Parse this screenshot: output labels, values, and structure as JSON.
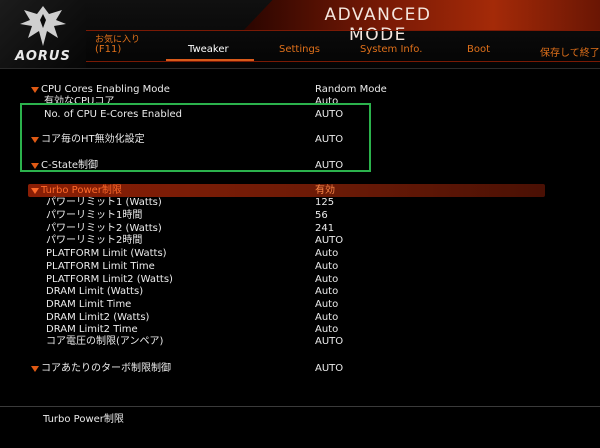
{
  "header": {
    "brand": "AORUS",
    "mode_title": "ADVANCED MODE",
    "favorites_line1": "お気に入り",
    "favorites_line2": "(F11)",
    "tabs": [
      {
        "label": "Tweaker",
        "active": true
      },
      {
        "label": "Settings",
        "active": false
      },
      {
        "label": "System Info.",
        "active": false
      },
      {
        "label": "Boot",
        "active": false
      },
      {
        "label": "保存して終了",
        "active": false
      }
    ]
  },
  "settings": [
    {
      "label": "CPU Cores Enabling Mode",
      "value": "Random Mode",
      "indent": 0,
      "collapsible": true
    },
    {
      "label": "有効なCPUコア",
      "value": "Auto",
      "indent": 0,
      "collapsible": false
    },
    {
      "label": "No. of CPU E-Cores Enabled",
      "value": "AUTO",
      "indent": 0,
      "collapsible": false
    },
    {
      "label": "コア毎のHT無効化設定",
      "value": "AUTO",
      "indent": 0,
      "collapsible": true
    },
    {
      "label": "C-State制御",
      "value": "AUTO",
      "indent": 0,
      "collapsible": true
    },
    {
      "label": "Turbo Power制限",
      "value": "有効",
      "indent": 0,
      "collapsible": true,
      "selected": true
    },
    {
      "label": "パワーリミット1 (Watts)",
      "value": "125",
      "indent": 1,
      "collapsible": false
    },
    {
      "label": "パワーリミット1時間",
      "value": "56",
      "indent": 1,
      "collapsible": false
    },
    {
      "label": "パワーリミット2 (Watts)",
      "value": "241",
      "indent": 1,
      "collapsible": false
    },
    {
      "label": "パワーリミット2時間",
      "value": "AUTO",
      "indent": 1,
      "collapsible": false
    },
    {
      "label": "PLATFORM Limit (Watts)",
      "value": "Auto",
      "indent": 1,
      "collapsible": false
    },
    {
      "label": "PLATFORM Limit Time",
      "value": "Auto",
      "indent": 1,
      "collapsible": false
    },
    {
      "label": "PLATFORM Limit2 (Watts)",
      "value": "Auto",
      "indent": 1,
      "collapsible": false
    },
    {
      "label": "DRAM Limit (Watts)",
      "value": "Auto",
      "indent": 1,
      "collapsible": false
    },
    {
      "label": "DRAM Limit Time",
      "value": "Auto",
      "indent": 1,
      "collapsible": false
    },
    {
      "label": "DRAM Limit2 (Watts)",
      "value": "Auto",
      "indent": 1,
      "collapsible": false
    },
    {
      "label": "DRAM Limit2 Time",
      "value": "Auto",
      "indent": 1,
      "collapsible": false
    },
    {
      "label": "コア電圧の制限(アンペア)",
      "value": "AUTO",
      "indent": 1,
      "collapsible": false
    },
    {
      "label": "コアあたりのターボ制限制御",
      "value": "AUTO",
      "indent": 0,
      "collapsible": true
    }
  ],
  "help_text": "Turbo Power制限",
  "colors": {
    "accent": "#e0701a",
    "selection": "#8a1e05",
    "highlight_box": "#2bb24c"
  },
  "icons": [
    "aorus-eagle-logo",
    "collapse-triangle-icon"
  ]
}
